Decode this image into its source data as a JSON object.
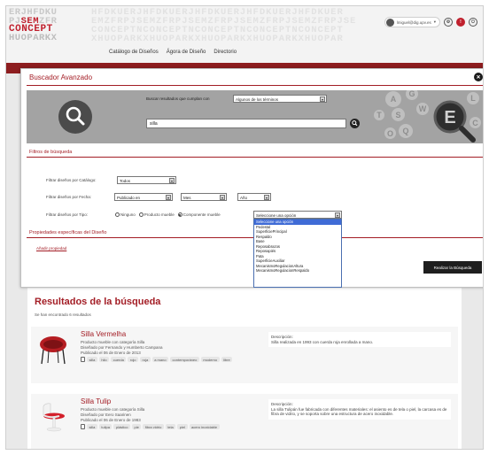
{
  "logo": {
    "line1": "ERJHFDKU",
    "line2_pre": "PJ",
    "line2_hl": "SEM",
    "line2_post": "ZFR",
    "line3": "CONCEPT",
    "line4": "HUOPARKX"
  },
  "background_letters": [
    "HFDKUERJHFDKUERJHFDKUERJHFDKUERJHFDKUER",
    "EMZFRPJSEMZFRPJSEMZFRPJSEMZFRPJSEMZFRPJSE",
    "CONCEPTNCONCEPTNCONCEPTNCONCEPTNCONCEPT",
    "XHUOPARKXHUOPARKXHUOPARKXHUOPARKXHUOPAR"
  ],
  "nav": [
    "Catálogo de Diseños",
    "Ágora de Diseño",
    "Directorio"
  ],
  "user": {
    "email": "lmiguel@dig.upv.es"
  },
  "modal": {
    "title": "Buscador Avanzado",
    "match_label": "Buscar resultados que cumplan con",
    "match_value": "Algunos de los términos",
    "search_value": "silla",
    "bubbles": [
      "A",
      "G",
      "S",
      "T",
      "W",
      "Q",
      "O",
      "L",
      "C"
    ],
    "filters_title": "Filtros de búsqueda",
    "filter_catalog_label": "Filtrar diseños por Catálogo:",
    "filter_catalog_value": "Todos",
    "filter_date_label": "Filtrar diseños por Fecha:",
    "filter_date_mode": "Publicado en",
    "filter_month": "Mes",
    "filter_year": "Año",
    "filter_type_label": "Filtrar diseños por Tipo:",
    "type_options": [
      "Ninguno",
      "Producto mueble",
      "Componente mueble"
    ],
    "type_selected_index": 2,
    "component_select_value": "Seleccione una opción",
    "component_options": [
      "Seleccione una opción",
      "Pedestal",
      "SuperficiePrincipal",
      "Respaldo",
      "Base",
      "Reposabrazos",
      "Reposapiés",
      "Pata",
      "SuperficieAuxiliar",
      "MecanismoRegulacionAltura",
      "MecanismoRegulacionRespaldo"
    ],
    "props_title": "Propiedades específicas del Diseño",
    "add_prop": "Añadir propiedad",
    "apply_button": "Realizar la Búsqueda"
  },
  "results": {
    "title": "Resultados de la búsqueda",
    "count_text": "Se han encontrado 6 resultados",
    "items": [
      {
        "name": "Silla Vermelha",
        "line1": "Producto mueble con categoría Silla",
        "line2": "Diseñado por Fernando y Humberto Campana",
        "line3": "Publicado el 06 de Enero de 2013",
        "tags": [
          "silla",
          "hilo",
          "cuerda",
          "rojo",
          "roja",
          "a mano",
          "contemporáneo",
          "moderno",
          "libre"
        ],
        "desc_label": "Descripción:",
        "desc": "Silla realizada en 1993 con cuerda roja enrollada a mano."
      },
      {
        "name": "Silla Tulip",
        "line1": "Producto mueble con categoría Silla",
        "line2": "Diseñado por Eero Saarinen",
        "line3": "Publicado el 06 de Enero de 1983",
        "tags": [
          "silla",
          "tulipa",
          "plástico",
          "pie",
          "fibra vidrio",
          "tela",
          "piel",
          "acero inoxidable"
        ],
        "desc_label": "Descripción:",
        "desc": "La silla Tulipán fue fabricada con diferentes materiales: el asiento es de tela o piel, la carcasa es de fibra de vidrio, y se soporta sobre una estructura de acero inoxidable."
      }
    ]
  },
  "colors": {
    "brand_red": "#a31d25",
    "dark_band": "#8d1d1f",
    "highlight": "#3f6bd6"
  }
}
